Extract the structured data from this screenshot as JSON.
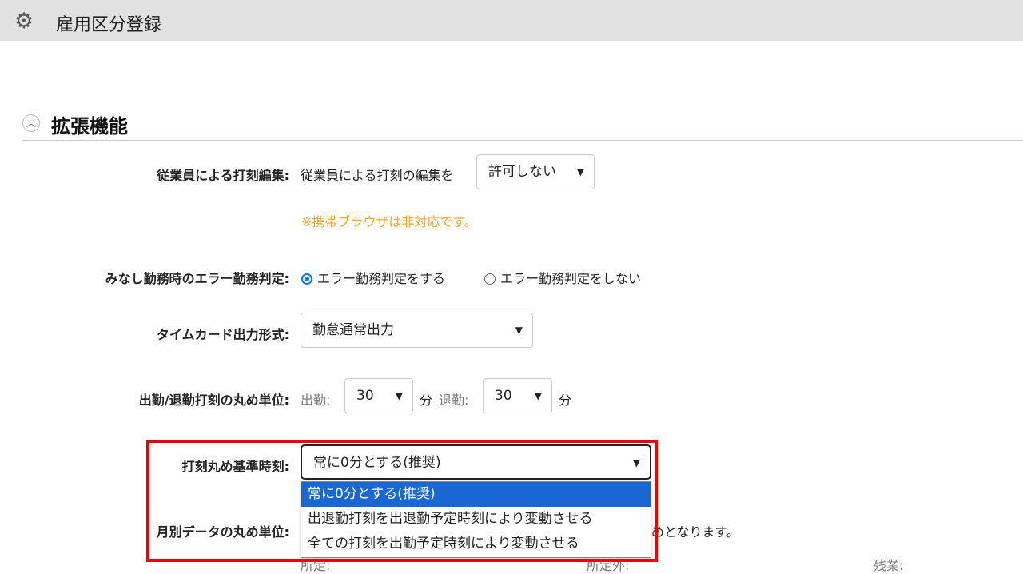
{
  "header": {
    "title": "雇用区分登録",
    "icon": "gear-icon"
  },
  "section": {
    "title": "拡張機能"
  },
  "punch_edit": {
    "label": "従業員による打刻編集:",
    "prefix": "従業員による打刻の編集を",
    "value": "許可しない",
    "note": "※携帯ブラウザは非対応です。"
  },
  "error_judge": {
    "label": "みなし勤務時のエラー勤務判定:",
    "options": [
      "エラー勤務判定をする",
      "エラー勤務判定をしない"
    ],
    "selected": 0
  },
  "timecard": {
    "label": "タイムカード出力形式:",
    "value": "勤怠通常出力"
  },
  "rounding": {
    "label": "出勤/退勤打刻の丸め単位:",
    "in_label": "出勤:",
    "in_value": "30",
    "unit": "分",
    "out_label": "退勤:",
    "out_value": "30"
  },
  "base_time": {
    "label": "打刻丸め基準時刻:",
    "value": "常に0分とする(推奨)",
    "options": [
      "常に0分とする(推奨)",
      "出退勤打刻を出退勤予定時刻により変動させる",
      "全ての打刻を出勤予定時刻により変動させる"
    ]
  },
  "monthly": {
    "label": "月別データの丸め単位:",
    "trailing": "めとなります。",
    "sub": [
      "所定:",
      "所定外:",
      "残業:"
    ]
  }
}
